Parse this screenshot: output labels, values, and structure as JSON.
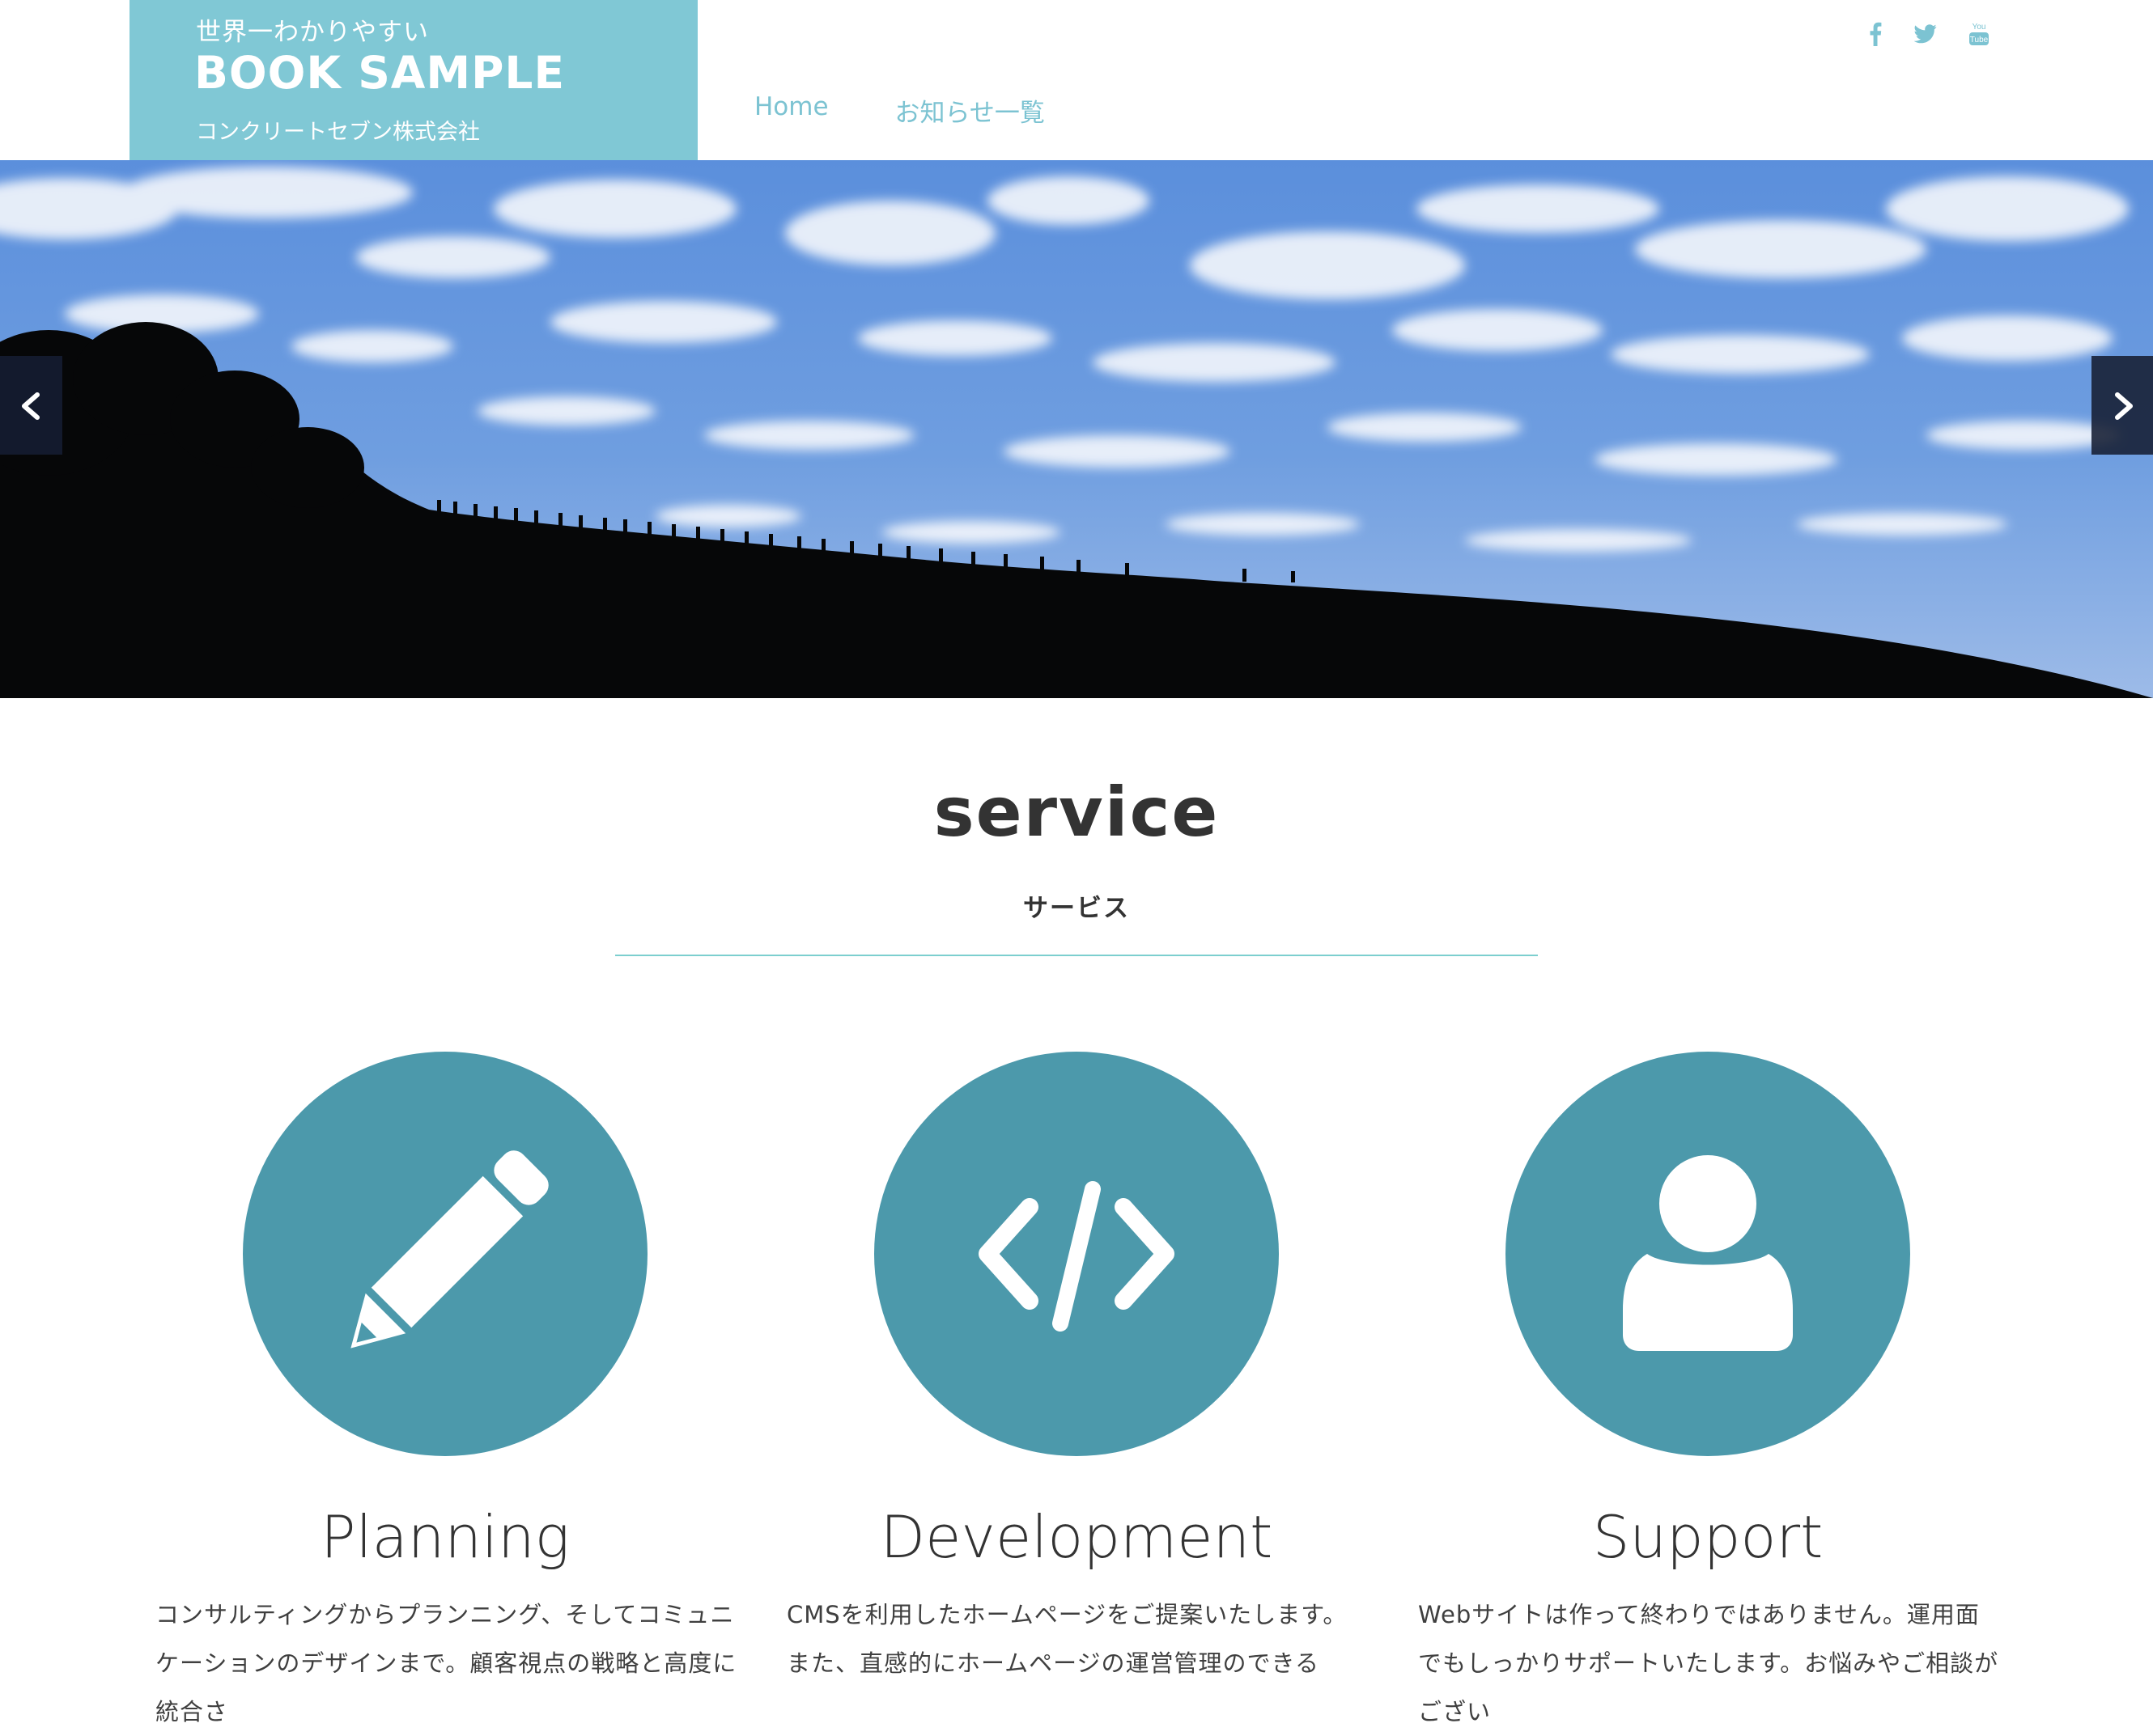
{
  "header": {
    "tagline": "世界一わかりやすい",
    "title": "BOOK SAMPLE",
    "company": "コンクリートセブン株式会社",
    "nav": [
      {
        "label": "Home"
      },
      {
        "label": "お知らせ一覧"
      }
    ],
    "social": [
      {
        "icon": "facebook-icon"
      },
      {
        "icon": "twitter-icon"
      },
      {
        "icon": "youtube-icon",
        "label": "You Tube"
      }
    ]
  },
  "slider": {
    "prev_icon": "chevron-left-icon",
    "next_icon": "chevron-right-icon"
  },
  "service": {
    "title": "service",
    "subtitle": "サービス",
    "cards": [
      {
        "icon": "pencil-icon",
        "title": "Planning",
        "text": "コンサルティングからプランニング、そしてコミュニケーションのデザインまで。顧客視点の戦略と高度に統合さ"
      },
      {
        "icon": "code-icon",
        "title": "Development",
        "text": "CMSを利用したホームページをご提案いたします。また、直感的にホームページの運営管理のできる"
      },
      {
        "icon": "user-icon",
        "title": "Support",
        "text": "Webサイトは作って終わりではありません。運用面でもしっかりサポートいたします。お悩みやご相談がござい"
      }
    ]
  },
  "colors": {
    "accent": "#80c8d5",
    "nav_link": "#7cc3d2",
    "circle": "#4c99ab",
    "divider": "#7ccfcf",
    "slider_arrow_bg": "#161e32"
  }
}
